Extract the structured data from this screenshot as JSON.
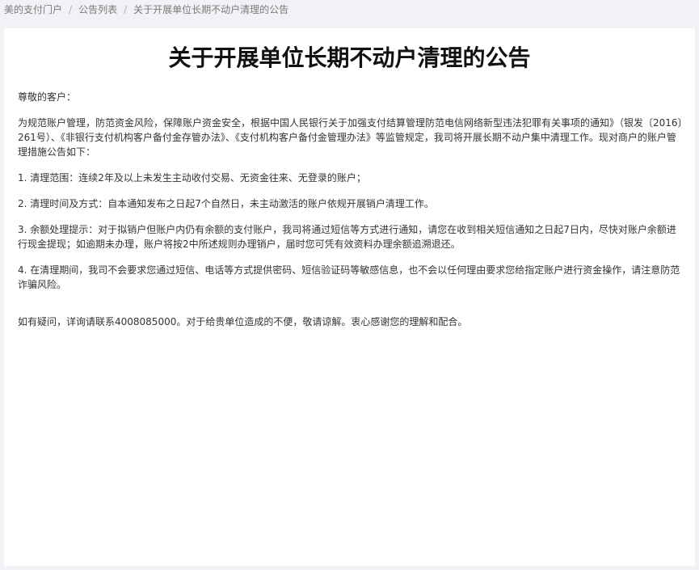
{
  "breadcrumb": {
    "items": [
      "美的支付门户",
      "公告列表",
      "关于开展单位长期不动户清理的公告"
    ],
    "separator": "/"
  },
  "notice": {
    "title": "关于开展单位长期不动户清理的公告",
    "greeting": "尊敬的客户：",
    "intro": "为规范账户管理，防范资金风险，保障账户资金安全，根据中国人民银行关于加强支付结算管理防范电信网络新型违法犯罪有关事项的通知》（银发〔2016〕261号）、《非银行支付机构客户备付金存管办法》、《支付机构客户备付金管理办法》等监管规定，我司将开展长期不动户集中清理工作。现对商户的账户管理措施公告如下：",
    "items": [
      "1. 清理范围：连续2年及以上未发生主动收付交易、无资金往来、无登录的账户；",
      "2. 清理时间及方式：自本通知发布之日起7个自然日，未主动激活的账户依规开展销户清理工作。",
      "3. 余额处理提示：对于拟销户但账户内仍有余额的支付账户，我司将通过短信等方式进行通知，请您在收到相关短信通知之日起7日内，尽快对账户余额进行现金提现；如逾期未办理，账户将按2中所述规则办理销户，届时您可凭有效资料办理余额追溯退还。",
      "4. 在清理期间，我司不会要求您通过短信、电话等方式提供密码、短信验证码等敏感信息，也不会以任何理由要求您给指定账户进行资金操作，请注意防范诈骗风险。"
    ],
    "closing": "如有疑问，详询请联系4008085000。对于给贵单位造成的不便，敬请谅解。衷心感谢您的理解和配合。"
  },
  "colors": {
    "page_background": "#f0f2f5",
    "card_background": "#ffffff",
    "title_text": "#111111",
    "body_text": "#333333",
    "breadcrumb_text": "#7a7a7a"
  }
}
